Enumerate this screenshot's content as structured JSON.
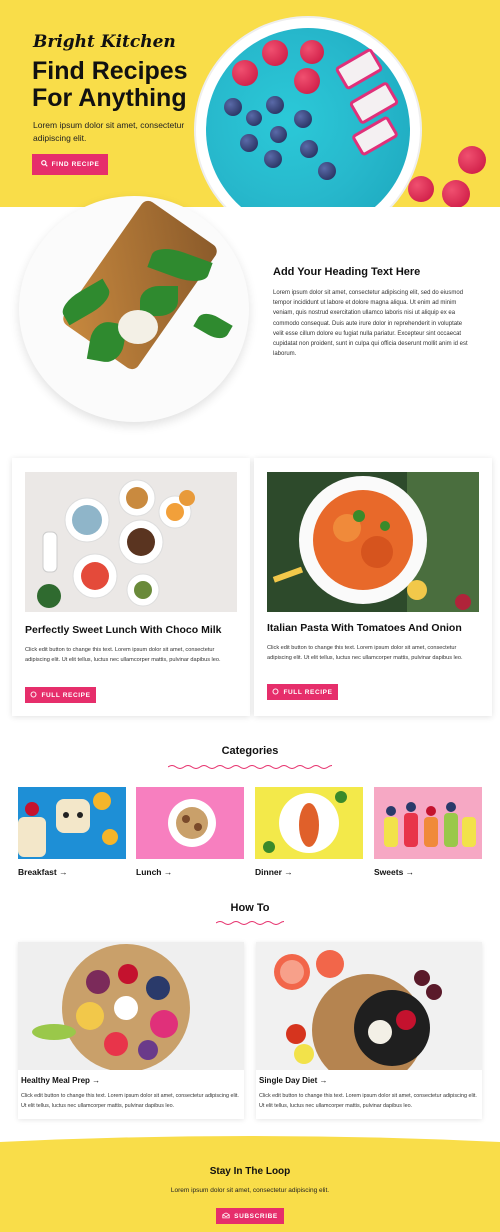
{
  "hero": {
    "brand": "Bright Kitchen",
    "title": "Find Recipes For Anything",
    "subtitle": "Lorem ipsum dolor sit amet, consectetur adipiscing elit.",
    "button_label": "FIND RECIPE",
    "button_icon": "search-icon"
  },
  "feature": {
    "heading": "Add Your Heading Text Here",
    "body": "Lorem ipsum dolor sit amet, consectetur adipiscing elit, sed do eiusmod tempor incididunt ut labore et dolore magna aliqua. Ut enim ad minim veniam, quis nostrud exercitation ullamco laboris nisi ut aliquip ex ea commodo consequat. Duis aute irure dolor in reprehenderit in voluptate velit esse cillum dolore eu fugiat nulla pariatur. Excepteur sint occaecat cupidatat non proident, sunt in culpa qui officia deserunt mollit anim id est laborum."
  },
  "recipes": [
    {
      "title": "Perfectly Sweet Lunch With Choco Milk",
      "body": "Click edit button to change this text. Lorem ipsum dolor sit amet, consectetur adipiscing elit. Ut elit tellus, luctus nec ullamcorper mattis, pulvinar dapibus leo.",
      "button_label": "FULL RECIPE"
    },
    {
      "title": "Italian Pasta With Tomatoes And Onion",
      "body": "Click edit button to change this text. Lorem ipsum dolor sit amet, consectetur adipiscing elit. Ut elit tellus, luctus nec ullamcorper mattis, pulvinar dapibus leo.",
      "button_label": "FULL RECIPE"
    }
  ],
  "categories": {
    "heading": "Categories",
    "items": [
      {
        "label": "Breakfast →"
      },
      {
        "label": "Lunch →"
      },
      {
        "label": "Dinner →"
      },
      {
        "label": "Sweets →"
      }
    ]
  },
  "howto": {
    "heading": "How To",
    "items": [
      {
        "title": "Healthy Meal Prep →",
        "body": "Click edit button to change this text. Lorem ipsum dolor sit amet, consectetur adipiscing elit. Ut elit tellus, luctus nec ullamcorper mattis, pulvinar dapibus leo."
      },
      {
        "title": "Single Day Diet →",
        "body": "Click edit button to change this text. Lorem ipsum dolor sit amet, consectetur adipiscing elit. Ut elit tellus, luctus nec ullamcorper mattis, pulvinar dapibus leo."
      }
    ]
  },
  "footer": {
    "heading": "Stay In The Loop",
    "text": "Lorem ipsum dolor sit amet, consectetur adipiscing elit.",
    "button_label": "SUBSCRIBE",
    "button_icon": "mail-icon"
  },
  "colors": {
    "accent": "#e62e6b",
    "yellow": "#f9dd49"
  }
}
